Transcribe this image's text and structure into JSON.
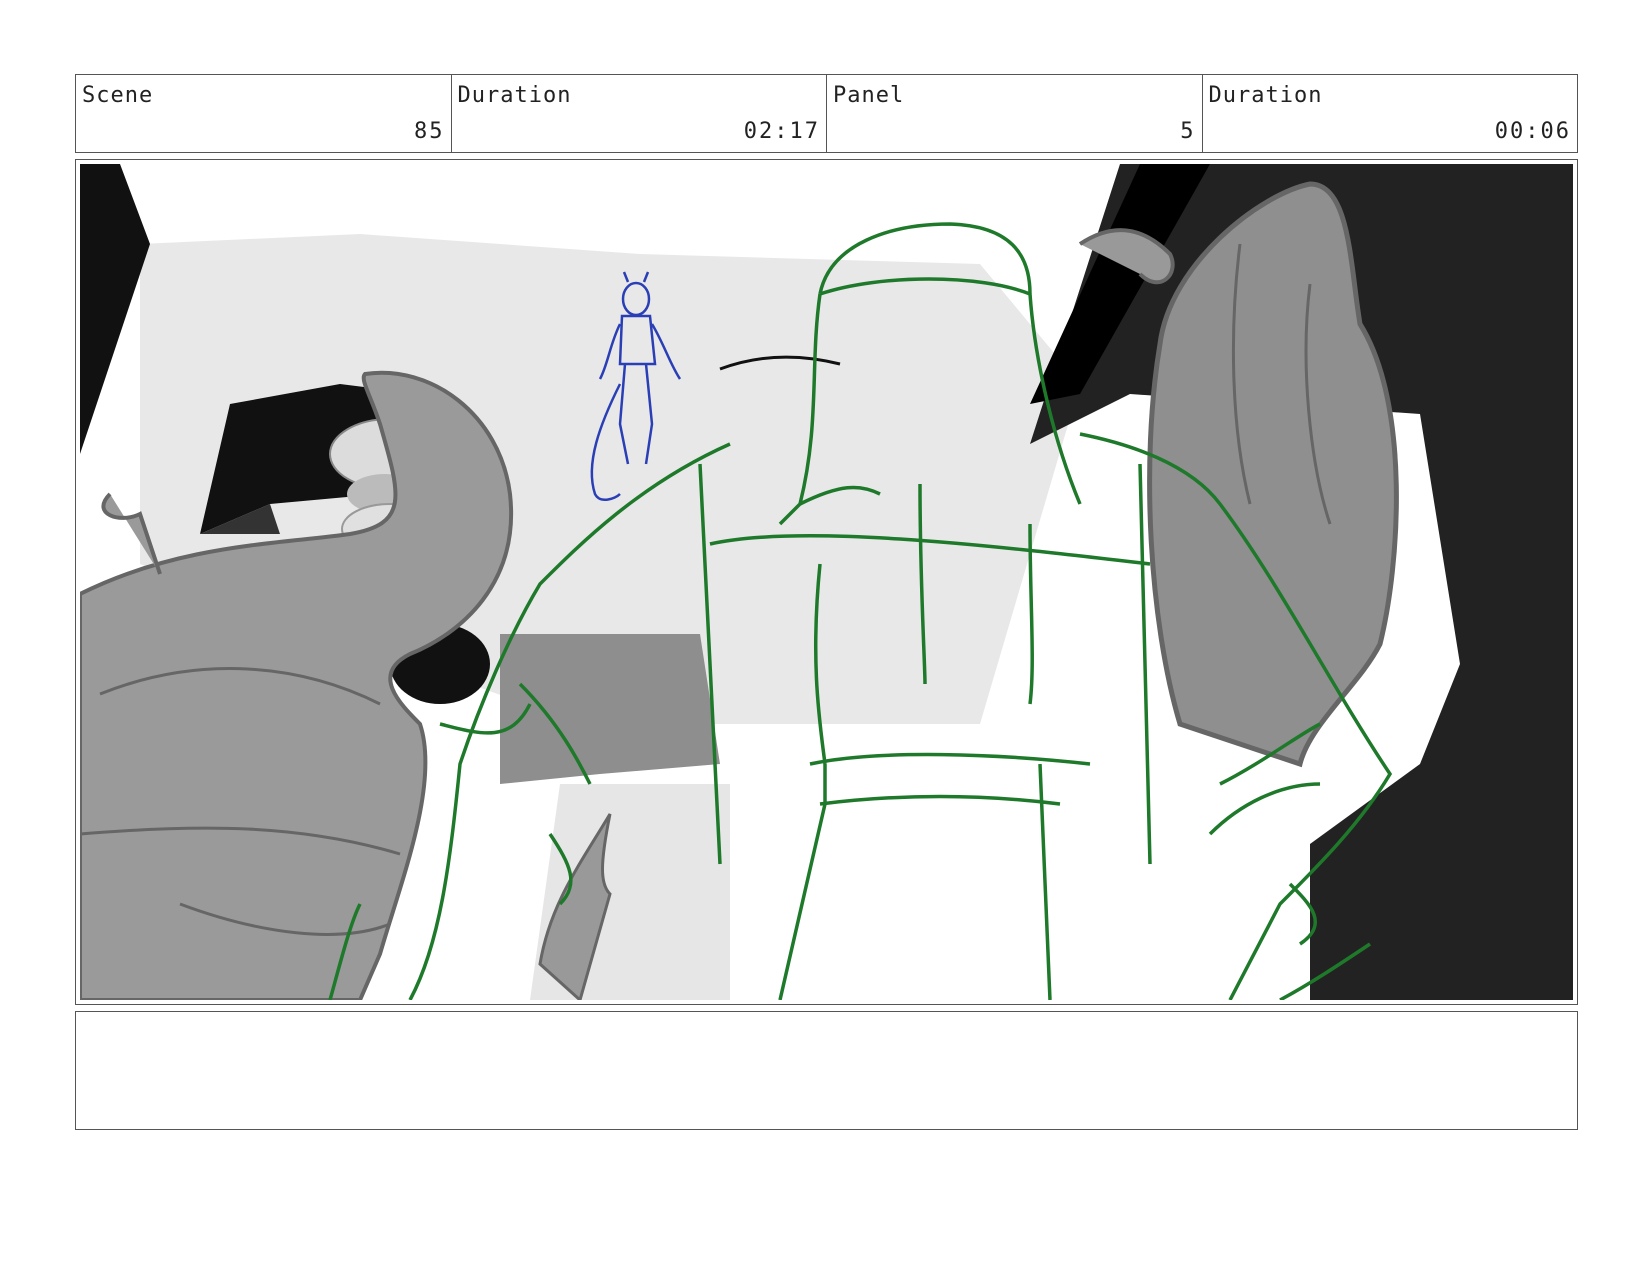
{
  "header": {
    "scene_label": "Scene",
    "scene_value": "85",
    "scene_duration_label": "Duration",
    "scene_duration_value": "02:17",
    "panel_label": "Panel",
    "panel_value": "5",
    "panel_duration_label": "Duration",
    "panel_duration_value": "00:06"
  },
  "notes": {
    "text": ""
  },
  "colors": {
    "foreground_sketch": "#1e7a2a",
    "background_sketch": "#2a3fb5",
    "frame_border": "#555555"
  },
  "icons": [
    "storyboard-panel-illustration"
  ]
}
